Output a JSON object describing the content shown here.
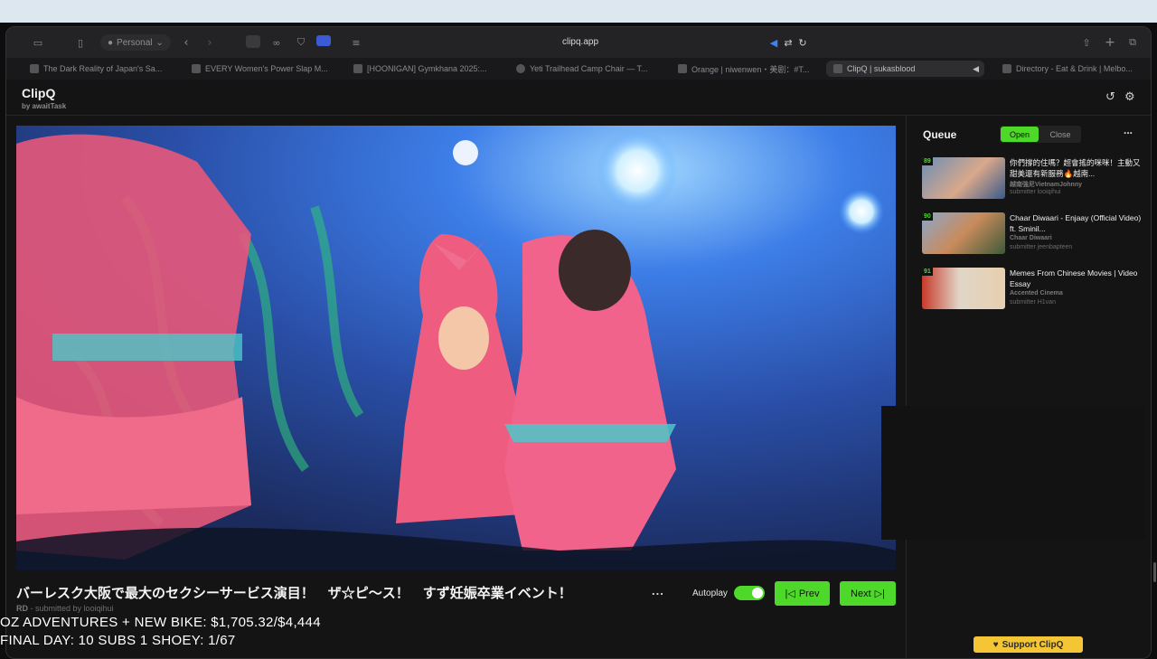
{
  "browser": {
    "profile_label": "Personal",
    "url": "clipq.app",
    "tabs": [
      {
        "title": "The Dark Reality of Japan's Sa..."
      },
      {
        "title": "EVERY Women's Power Slap M..."
      },
      {
        "title": "[HOONIGAN] Gymkhana 2025:..."
      },
      {
        "title": "Yeti Trailhead Camp Chair — T..."
      },
      {
        "title": "Orange | niwenwen・美剧：#T..."
      },
      {
        "title": "ClipQ | sukasblood"
      },
      {
        "title": "Directory - Eat & Drink | Melbo..."
      }
    ]
  },
  "app": {
    "name": "ClipQ",
    "byline": "by awaitTask"
  },
  "player": {
    "title": "バーレスク大阪で最大のセクシーサービス演目！　ザ☆ピ～ス！　すず妊娠卒業イベント！",
    "channel": "RD",
    "submitted_prefix": "- submitted by",
    "submitter": "looiqihui",
    "more": "...",
    "autoplay_label": "Autoplay",
    "autoplay_on": true,
    "prev_label": "Prev",
    "next_label": "Next"
  },
  "queue": {
    "title": "Queue",
    "open_label": "Open",
    "close_label": "Close",
    "more": "...",
    "items": [
      {
        "number": "89",
        "title": "你們撐的住嗎？超會搖的咪咪！主動又甜美還有新服務🔥越南...",
        "channel": "越南強尼VietnamJohnny",
        "submitter": "submitter looiqihui"
      },
      {
        "number": "90",
        "title": "Chaar Diwaari - Enjaay (Official Video) ft. Sminil...",
        "channel": "Chaar Diwaari",
        "submitter": "submitter jeenbapteen"
      },
      {
        "number": "91",
        "title": "Memes From Chinese Movies | Video Essay",
        "channel": "Accented Cinema",
        "submitter": "submitter H1van"
      }
    ]
  },
  "support_label": "Support ClipQ",
  "stream_overlay": {
    "line1": "OZ ADVENTURES + NEW BIKE: $1,705.32/$4,444",
    "line2": "FINAL DAY: 10 SUBS 1 SHOEY: 1/67"
  },
  "colors": {
    "accent": "#4ed82a",
    "support": "#f4c534",
    "background": "#141414"
  }
}
